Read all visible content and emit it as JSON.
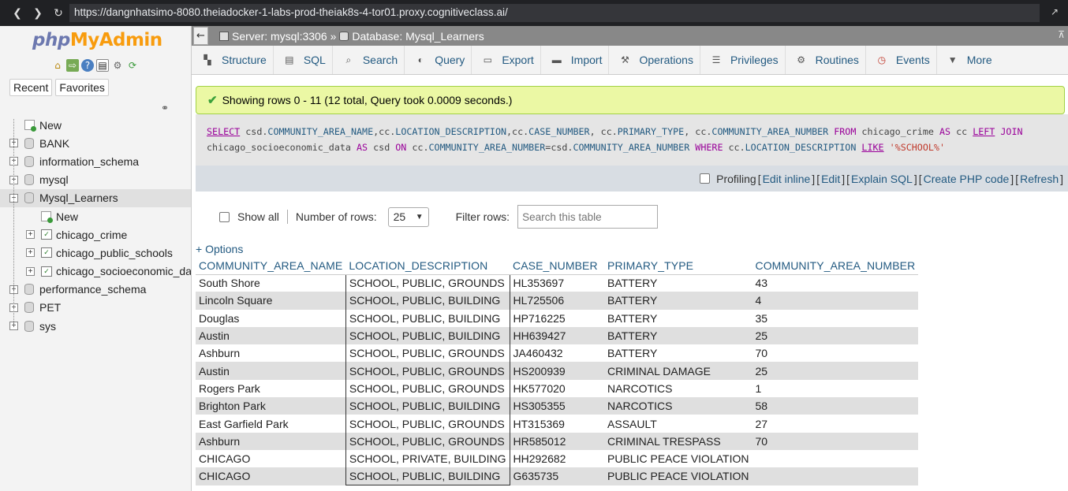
{
  "browser": {
    "url": "https://dangnhatsimo-8080.theiadocker-1-labs-prod-theiak8s-4-tor01.proxy.cognitiveclass.ai/"
  },
  "nav": {
    "logo_php": "php",
    "logo_myadmin": "MyAdmin",
    "recent_label": "Recent",
    "favorites_label": "Favorites",
    "tree": [
      {
        "label": "New",
        "level": 0,
        "type": "new"
      },
      {
        "label": "BANK",
        "level": 0,
        "type": "db"
      },
      {
        "label": "information_schema",
        "level": 0,
        "type": "db"
      },
      {
        "label": "mysql",
        "level": 0,
        "type": "db"
      },
      {
        "label": "Mysql_Learners",
        "level": 0,
        "type": "db",
        "expanded": true,
        "selected": true
      },
      {
        "label": "New",
        "level": 1,
        "type": "new"
      },
      {
        "label": "chicago_crime",
        "level": 1,
        "type": "table"
      },
      {
        "label": "chicago_public_schools",
        "level": 1,
        "type": "table"
      },
      {
        "label": "chicago_socioeconomic_data",
        "level": 1,
        "type": "table"
      },
      {
        "label": "performance_schema",
        "level": 0,
        "type": "db"
      },
      {
        "label": "PET",
        "level": 0,
        "type": "db"
      },
      {
        "label": "sys",
        "level": 0,
        "type": "db"
      }
    ]
  },
  "breadcrumb": {
    "server": "Server: mysql:3306",
    "sep": "»",
    "database": "Database: Mysql_Learners"
  },
  "menu": [
    {
      "label": "Structure",
      "icon": "structure-icon"
    },
    {
      "label": "SQL",
      "icon": "sql-icon"
    },
    {
      "label": "Search",
      "icon": "search-icon"
    },
    {
      "label": "Query",
      "icon": "query-icon"
    },
    {
      "label": "Export",
      "icon": "export-icon"
    },
    {
      "label": "Import",
      "icon": "import-icon"
    },
    {
      "label": "Operations",
      "icon": "wrench-icon"
    },
    {
      "label": "Privileges",
      "icon": "privileges-icon"
    },
    {
      "label": "Routines",
      "icon": "routines-icon"
    },
    {
      "label": "Events",
      "icon": "clock-icon"
    },
    {
      "label": "More",
      "icon": "chevron-down-icon"
    }
  ],
  "message": "Showing rows 0 - 11 (12 total, Query took 0.0009 seconds.)",
  "sql_links": {
    "profiling": "Profiling",
    "edit_inline": "Edit inline",
    "edit": "Edit",
    "explain": "Explain SQL",
    "create_php": "Create PHP code",
    "refresh": "Refresh"
  },
  "controls": {
    "show_all": "Show all",
    "number_of_rows": "Number of rows:",
    "rows_value": "25",
    "filter_rows": "Filter rows:",
    "search_placeholder": "Search this table",
    "options": "+ Options"
  },
  "results": {
    "columns": [
      "COMMUNITY_AREA_NAME",
      "LOCATION_DESCRIPTION",
      "CASE_NUMBER",
      "PRIMARY_TYPE",
      "COMMUNITY_AREA_NUMBER"
    ],
    "rows": [
      [
        "South Shore",
        "SCHOOL, PUBLIC, GROUNDS",
        "HL353697",
        "BATTERY",
        "43"
      ],
      [
        "Lincoln Square",
        "SCHOOL, PUBLIC, BUILDING",
        "HL725506",
        "BATTERY",
        "4"
      ],
      [
        "Douglas",
        "SCHOOL, PUBLIC, BUILDING",
        "HP716225",
        "BATTERY",
        "35"
      ],
      [
        "Austin",
        "SCHOOL, PUBLIC, BUILDING",
        "HH639427",
        "BATTERY",
        "25"
      ],
      [
        "Ashburn",
        "SCHOOL, PUBLIC, GROUNDS",
        "JA460432",
        "BATTERY",
        "70"
      ],
      [
        "Austin",
        "SCHOOL, PUBLIC, GROUNDS",
        "HS200939",
        "CRIMINAL DAMAGE",
        "25"
      ],
      [
        "Rogers Park",
        "SCHOOL, PUBLIC, GROUNDS",
        "HK577020",
        "NARCOTICS",
        "1"
      ],
      [
        "Brighton Park",
        "SCHOOL, PUBLIC, BUILDING",
        "HS305355",
        "NARCOTICS",
        "58"
      ],
      [
        "East Garfield Park",
        "SCHOOL, PUBLIC, GROUNDS",
        "HT315369",
        "ASSAULT",
        "27"
      ],
      [
        "Ashburn",
        "SCHOOL, PUBLIC, GROUNDS",
        "HR585012",
        "CRIMINAL TRESPASS",
        "70"
      ],
      [
        "CHICAGO",
        "SCHOOL, PRIVATE, BUILDING",
        "HH292682",
        "PUBLIC PEACE VIOLATION",
        ""
      ],
      [
        "CHICAGO",
        "SCHOOL, PUBLIC, BUILDING",
        "G635735",
        "PUBLIC PEACE VIOLATION",
        ""
      ]
    ]
  }
}
